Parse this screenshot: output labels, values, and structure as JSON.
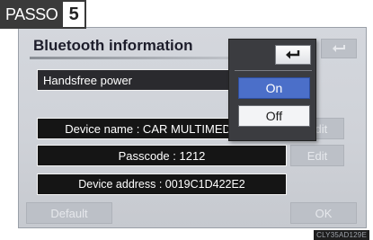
{
  "step_tag": {
    "label": "PASSO",
    "number": "5"
  },
  "screen": {
    "title": "Bluetooth information",
    "handsfree_label": "Handsfree power",
    "device_name": "Device name : CAR MULTIMED...",
    "passcode": "Passcode : 1212",
    "device_address": "Device address : 0019C1D422E2",
    "edit_label_1": "Edit",
    "edit_label_2": "Edit",
    "default_label": "Default",
    "ok_label": "OK"
  },
  "popup": {
    "on_label": "On",
    "off_label": "Off",
    "selected": "On"
  },
  "footer": {
    "image_code": "CLY35AD129E"
  },
  "colors": {
    "selected_option": "#4b6fc9",
    "screen_bg": "#d4d7dd",
    "bar_bg": "#151515"
  },
  "icons": {
    "back": "return-arrow-icon"
  }
}
